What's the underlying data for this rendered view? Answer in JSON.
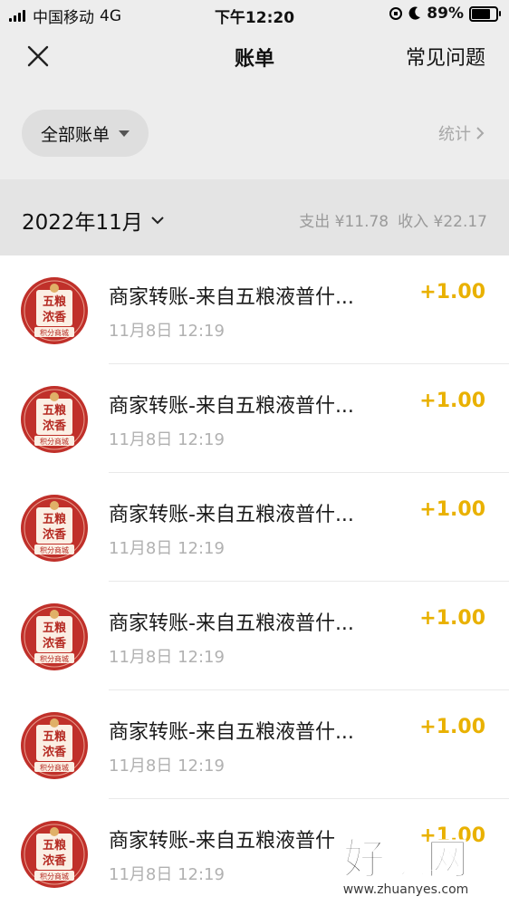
{
  "status_bar": {
    "carrier": "中国移动",
    "network": "4G",
    "time": "下午12:20",
    "battery": "89%",
    "battery_level": 0.89
  },
  "nav": {
    "title": "账单",
    "faq_label": "常见问题",
    "close_icon": "close-icon"
  },
  "filter": {
    "label": "全部账单",
    "stats_label": "统计"
  },
  "month_header": {
    "month": "2022年11月",
    "expense": "支出 ¥11.78",
    "income": "收入 ¥22.17"
  },
  "transactions": [
    {
      "title": "商家转账-来自五粮液普什...",
      "time": "11月8日 12:19",
      "amount": "+1.00"
    },
    {
      "title": "商家转账-来自五粮液普什...",
      "time": "11月8日 12:19",
      "amount": "+1.00"
    },
    {
      "title": "商家转账-来自五粮液普什...",
      "time": "11月8日 12:19",
      "amount": "+1.00"
    },
    {
      "title": "商家转账-来自五粮液普什...",
      "time": "11月8日 12:19",
      "amount": "+1.00"
    },
    {
      "title": "商家转账-来自五粮液普什...",
      "time": "11月8日 12:19",
      "amount": "+1.00"
    },
    {
      "title": "商家转账-来自五粮液普什",
      "time": "11月8日 12:19",
      "amount": "+1.00"
    }
  ],
  "merchant_logo": {
    "top_text": "五粮",
    "bottom_text": "浓香",
    "caption": "积分商城"
  },
  "watermark": {
    "title": "好赚网",
    "url": "www.zhuanyes.com"
  },
  "colors": {
    "income": "#e9b100",
    "logo_red": "#c0302a",
    "background": "#ededed"
  }
}
